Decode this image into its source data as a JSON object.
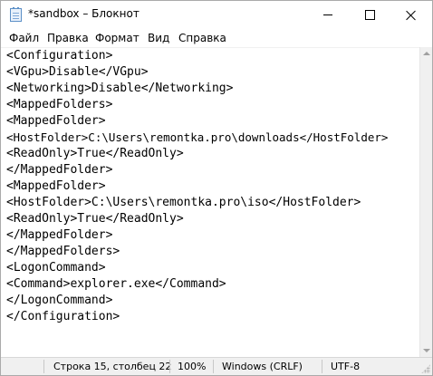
{
  "window": {
    "title": "*sandbox – Блокнот"
  },
  "menu": {
    "file": "Файл",
    "edit": "Правка",
    "format": "Формат",
    "view": "Вид",
    "help": "Справка"
  },
  "editor": {
    "lines": [
      "<Configuration>",
      "<VGpu>Disable</VGpu>",
      "<Networking>Disable</Networking>",
      "<MappedFolders>",
      "<MappedFolder>",
      "<HostFolder>C:\\Users\\remontka.pro\\downloads</HostFolder>",
      "<ReadOnly>True</ReadOnly>",
      "</MappedFolder>",
      "<MappedFolder>",
      "<HostFolder>C:\\Users\\remontka.pro\\iso</HostFolder>",
      "<ReadOnly>True</ReadOnly>",
      "</MappedFolder>",
      "</MappedFolders>",
      "<LogonCommand>",
      "<Command>explorer.exe</Command>",
      "</LogonCommand>",
      "</Configuration>"
    ]
  },
  "status": {
    "position": "Строка 15, столбец 22",
    "zoom": "100%",
    "line_endings": "Windows (CRLF)",
    "encoding": "UTF-8"
  },
  "icons": {
    "app": "notepad-icon",
    "minimize": "minimize-icon",
    "maximize": "maximize-icon",
    "close": "close-icon"
  }
}
